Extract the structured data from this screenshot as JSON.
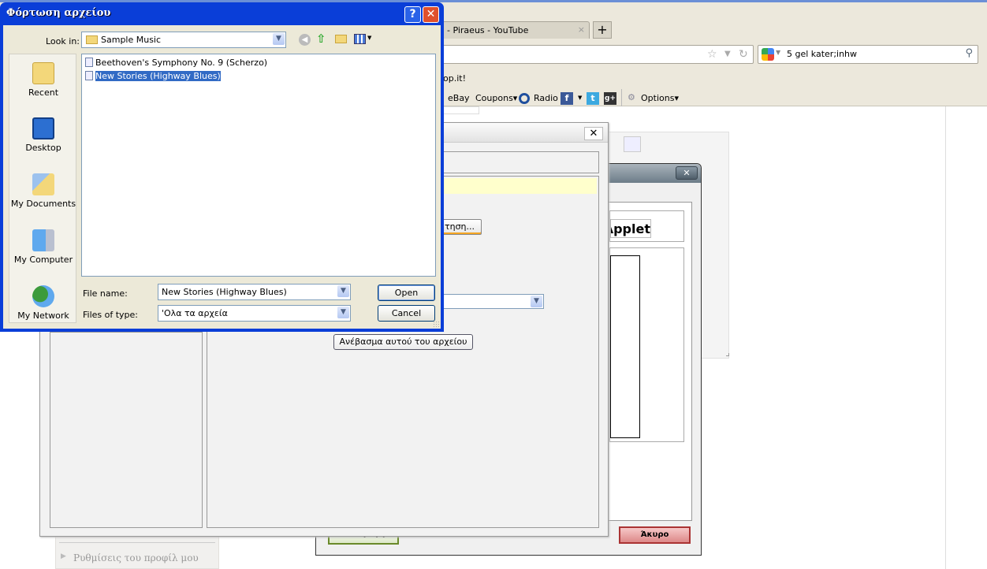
{
  "browser": {
    "tab_title": "- Piraeus - YouTube",
    "tab_close": "×",
    "new_tab": "+",
    "search_value": "5 gel kater;inhw",
    "bookmark_partial": "op.it!",
    "toolbar": [
      "eBay",
      "Coupons▾",
      "Radio",
      "Options▾"
    ],
    "social": [
      "f",
      "t",
      "g+"
    ]
  },
  "page": {
    "sidebar_item": "Ρυθμίσεις του προφίλ μου"
  },
  "dialog_back": {
    "close": "✕",
    "applet_button": "Applet...",
    "insert_button": "Εισαγωγή",
    "cancel_button": "Άκυρο",
    "colors": {
      "insert_border": "#6a8a2a",
      "cancel_border": "#aa3333"
    }
  },
  "dialog_upload": {
    "close": "✕",
    "browse_button": "Αναζήτηση...",
    "upload_button": "Ανέβασμα αυτού του αρχείου"
  },
  "file_dialog": {
    "title": "Φόρτωση αρχείου",
    "help": "?",
    "close": "✕",
    "look_in_label": "Look in:",
    "look_in_value": "Sample Music",
    "places": [
      "Recent",
      "Desktop",
      "My Documents",
      "My Computer",
      "My Network"
    ],
    "files": [
      {
        "name": "Beethoven's Symphony No. 9 (Scherzo)",
        "selected": false
      },
      {
        "name": "New Stories (Highway Blues)",
        "selected": true
      }
    ],
    "file_name_label": "File name:",
    "file_name_value": "New Stories (Highway Blues)",
    "file_type_label": "Files of type:",
    "file_type_value": "'Ολα τα αρχεία",
    "open_button": "Open",
    "cancel_button": "Cancel"
  }
}
